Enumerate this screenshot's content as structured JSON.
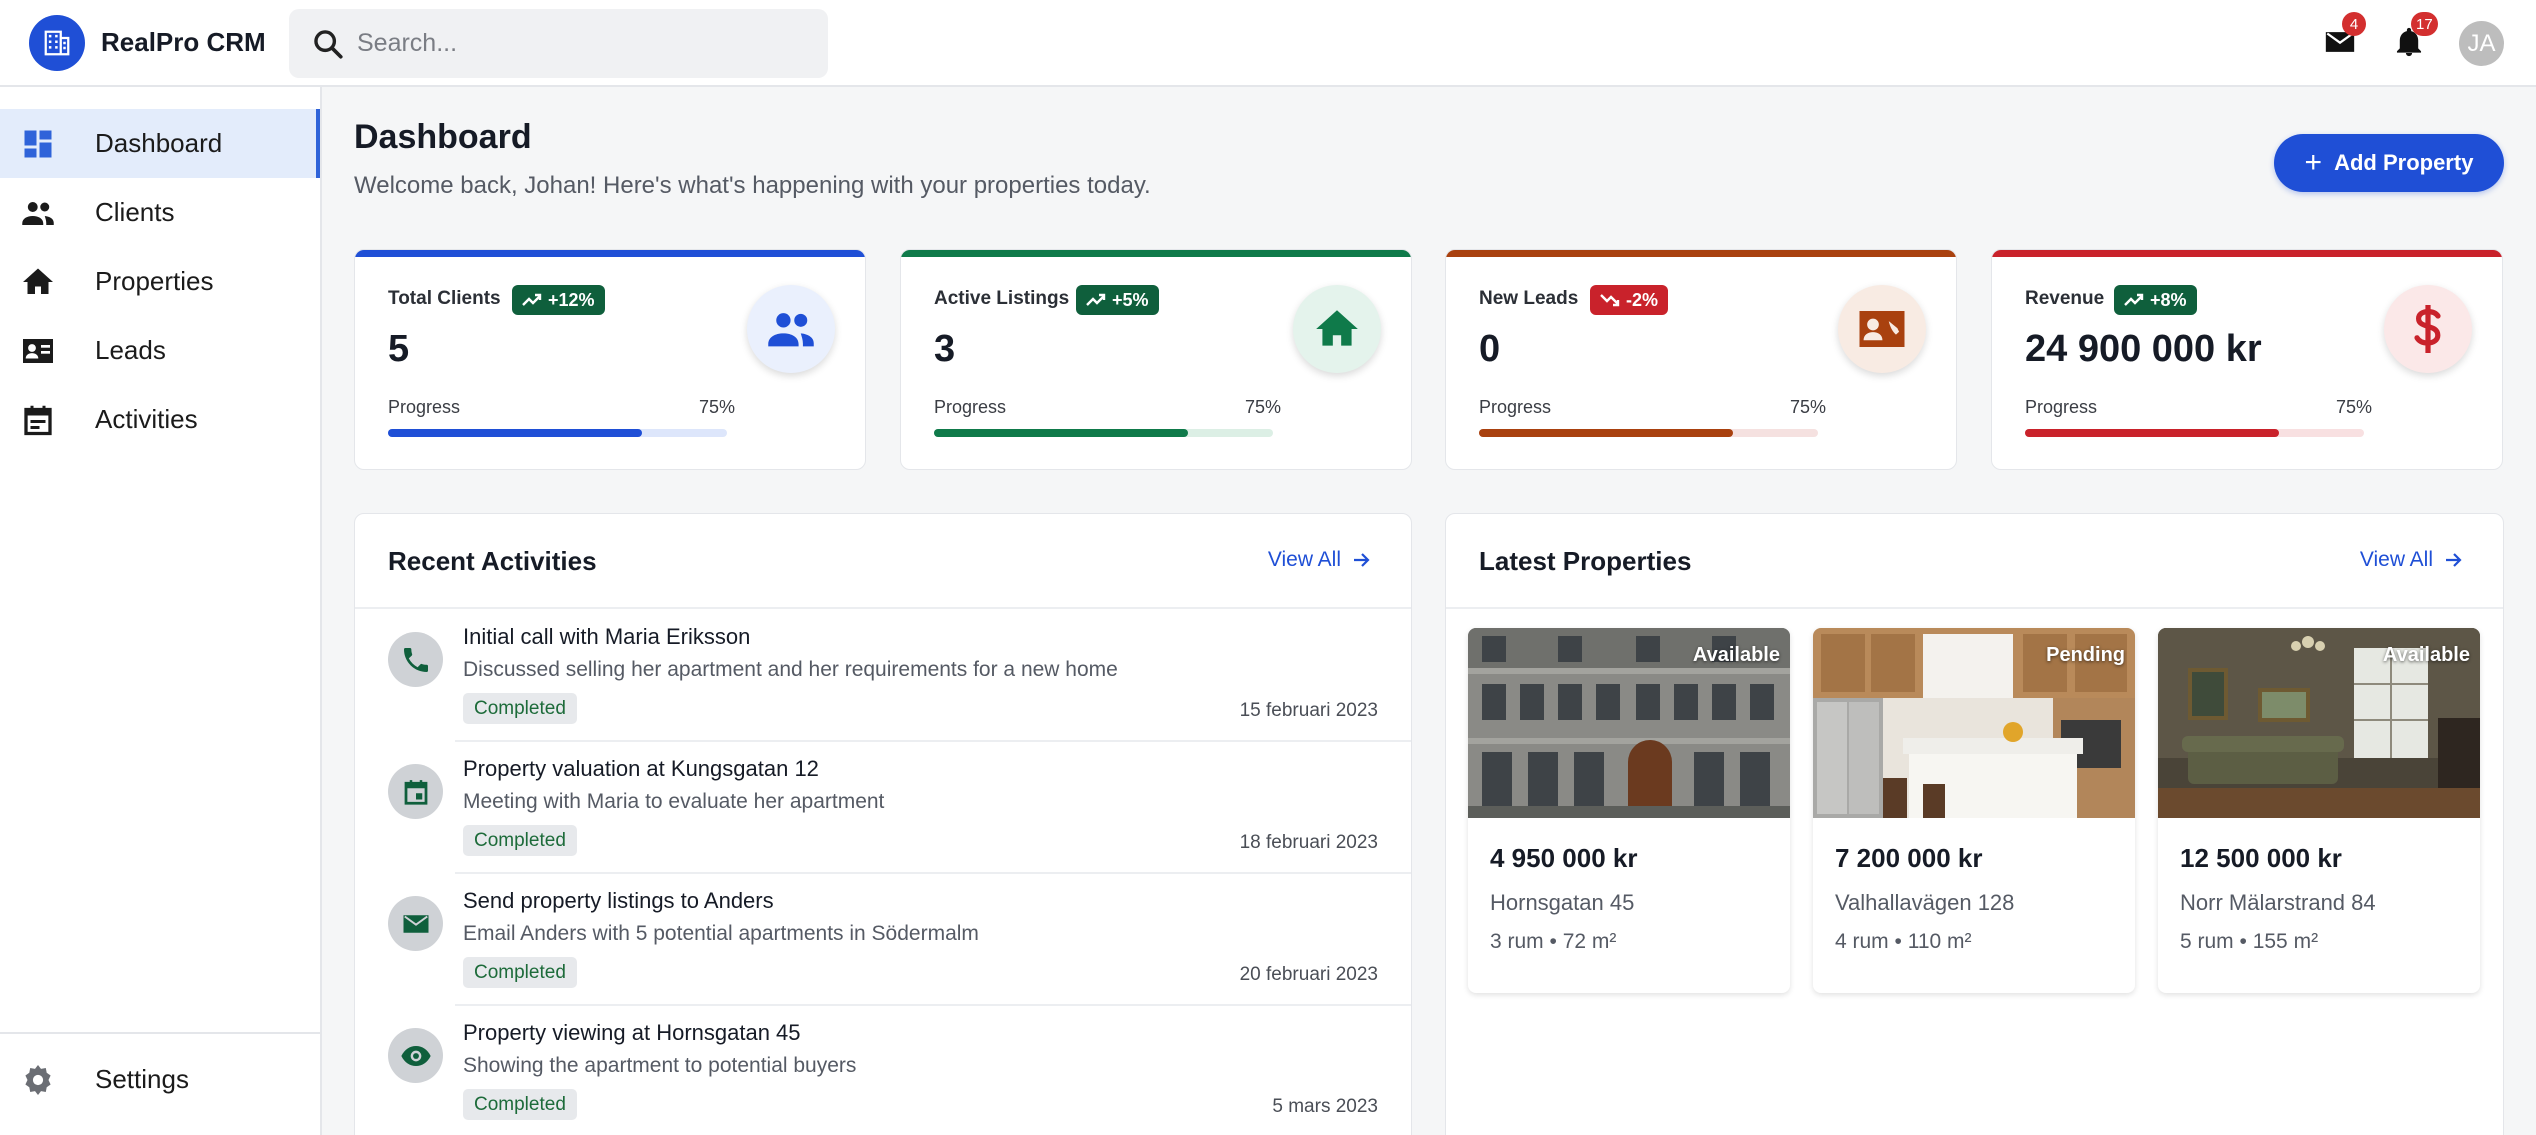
{
  "app": {
    "name": "RealPro CRM",
    "search_placeholder": "Search...",
    "mail_count": "4",
    "notification_count": "17",
    "avatar_initials": "JA"
  },
  "sidebar": {
    "items": [
      {
        "label": "Dashboard",
        "icon": "dashboard-icon",
        "active": true
      },
      {
        "label": "Clients",
        "icon": "people-icon",
        "active": false
      },
      {
        "label": "Properties",
        "icon": "home-icon",
        "active": false
      },
      {
        "label": "Leads",
        "icon": "contact-card-icon",
        "active": false
      },
      {
        "label": "Activities",
        "icon": "calendar-icon",
        "active": false
      }
    ],
    "settings_label": "Settings"
  },
  "header": {
    "title": "Dashboard",
    "subtitle": "Welcome back, Johan! Here's what's happening with your properties today.",
    "add_button": "Add Property"
  },
  "stats": [
    {
      "label": "Total Clients",
      "trend": "+12%",
      "trend_direction": "up",
      "value": "5",
      "progress_label": "Progress",
      "progress_pct": "75%",
      "progress": 0.75,
      "color": "#1f4fd6",
      "icon": "people-icon"
    },
    {
      "label": "Active Listings",
      "trend": "+5%",
      "trend_direction": "up",
      "value": "3",
      "progress_label": "Progress",
      "progress_pct": "75%",
      "progress": 0.75,
      "color": "#0f7a4a",
      "icon": "home-icon"
    },
    {
      "label": "New Leads",
      "trend": "-2%",
      "trend_direction": "down",
      "value": "0",
      "progress_label": "Progress",
      "progress_pct": "75%",
      "progress": 0.75,
      "color": "#a9410f",
      "icon": "contact-card-icon"
    },
    {
      "label": "Revenue",
      "trend": "+8%",
      "trend_direction": "up",
      "value": "24 900 000 kr",
      "progress_label": "Progress",
      "progress_pct": "75%",
      "progress": 0.75,
      "color": "#c9222b",
      "icon": "dollar-icon"
    }
  ],
  "activities_panel": {
    "title": "Recent Activities",
    "view_all": "View All",
    "items": [
      {
        "title": "Initial call with Maria Eriksson",
        "description": "Discussed selling her apartment and her requirements for a new home",
        "status": "Completed",
        "date": "15 februari 2023",
        "icon": "phone-icon"
      },
      {
        "title": "Property valuation at Kungsgatan 12",
        "description": "Meeting with Maria to evaluate her apartment",
        "status": "Completed",
        "date": "18 februari 2023",
        "icon": "event-icon"
      },
      {
        "title": "Send property listings to Anders",
        "description": "Email Anders with 5 potential apartments in Södermalm",
        "status": "Completed",
        "date": "20 februari 2023",
        "icon": "mail-icon"
      },
      {
        "title": "Property viewing at Hornsgatan 45",
        "description": "Showing the apartment to potential buyers",
        "status": "Completed",
        "date": "5 mars 2023",
        "icon": "eye-icon"
      }
    ]
  },
  "properties_panel": {
    "title": "Latest Properties",
    "view_all": "View All",
    "items": [
      {
        "status": "Available",
        "price": "4 950 000 kr",
        "address": "Hornsgatan 45",
        "specs": "3 rum • 72 m²"
      },
      {
        "status": "Pending",
        "price": "7 200 000 kr",
        "address": "Valhallavägen 128",
        "specs": "4 rum • 110 m²"
      },
      {
        "status": "Available",
        "price": "12 500 000 kr",
        "address": "Norr Mälarstrand 84",
        "specs": "5 rum • 155 m²"
      }
    ]
  },
  "colors": {
    "primary": "#1f4fd6",
    "success_badge": "#0f5f3c",
    "danger_badge": "#c9222b",
    "active_nav_bg": "#e3ecfb"
  }
}
